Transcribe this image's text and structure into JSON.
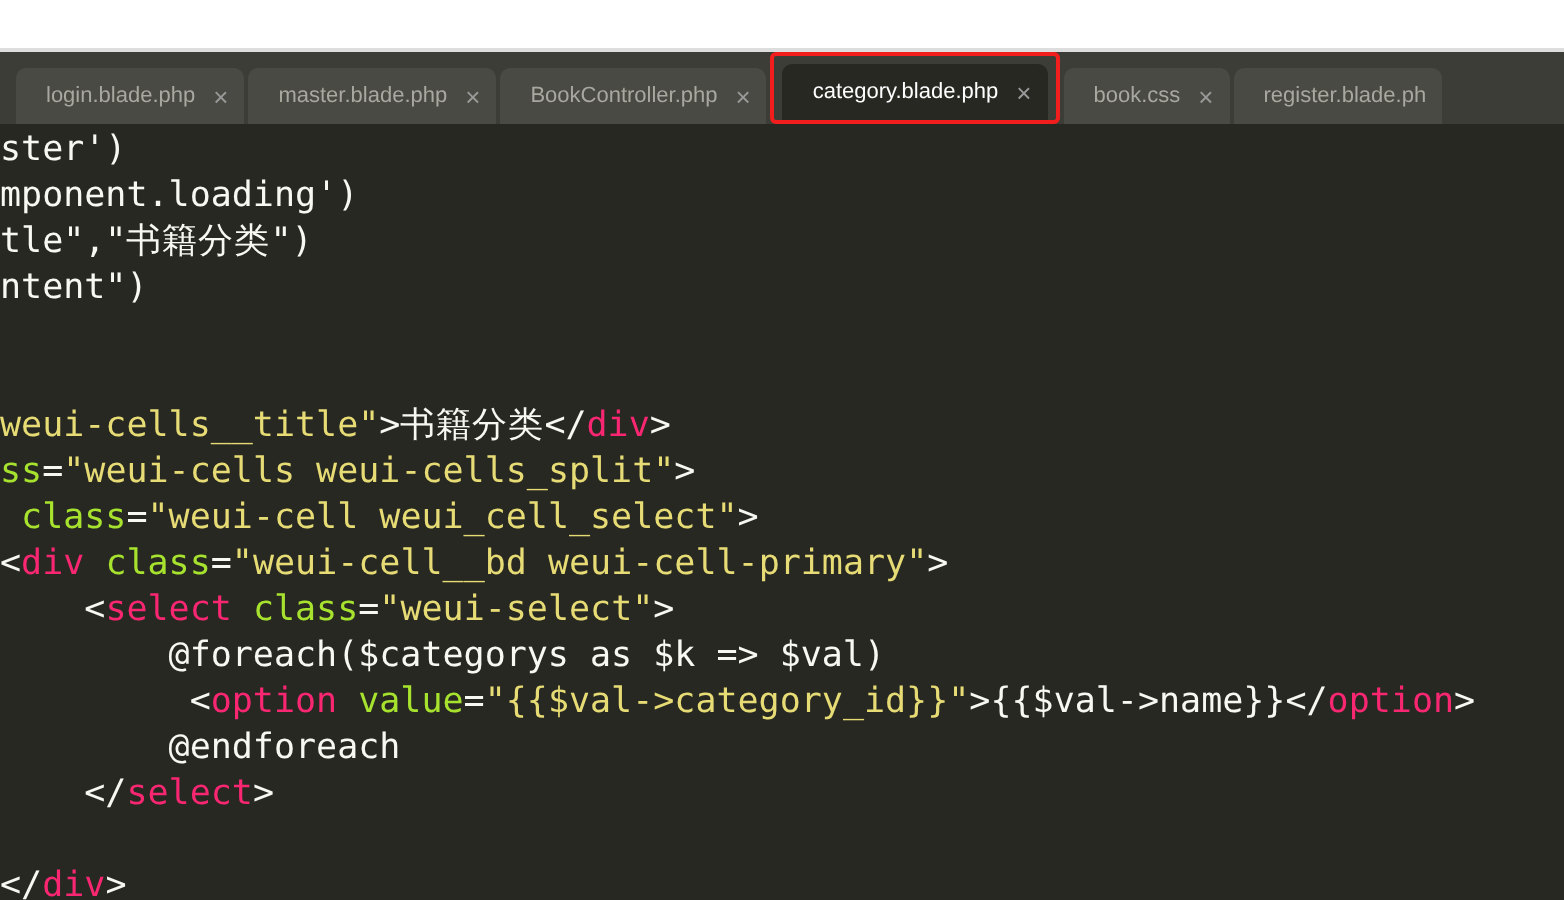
{
  "tabs": [
    {
      "label": "login.blade.php",
      "close": "×",
      "selected": false
    },
    {
      "label": "master.blade.php",
      "close": "×",
      "selected": false
    },
    {
      "label": "BookController.php",
      "close": "×",
      "selected": false
    },
    {
      "label": "category.blade.php",
      "close": "×",
      "selected": true
    },
    {
      "label": "book.css",
      "close": "×",
      "selected": false
    },
    {
      "label": "register.blade.ph",
      "selected": false
    }
  ],
  "code_lines": [
    {
      "kind": "code",
      "tokens": [
        {
          "kind": "plain",
          "text": "ster')"
        }
      ]
    },
    {
      "kind": "code",
      "tokens": [
        {
          "kind": "plain",
          "text": "mponent.loading')"
        }
      ]
    },
    {
      "kind": "code",
      "tokens": [
        {
          "kind": "plain",
          "text": "tle\",\"书籍分类\")"
        }
      ]
    },
    {
      "kind": "code",
      "tokens": [
        {
          "kind": "plain",
          "text": "ntent\")"
        }
      ]
    },
    {
      "kind": "blank"
    },
    {
      "kind": "blank"
    },
    {
      "kind": "code",
      "tokens": [
        {
          "kind": "string",
          "text": "weui-cells__title\""
        },
        {
          "kind": "plain",
          "text": ">书籍分类</"
        },
        {
          "kind": "tag",
          "text": "div"
        },
        {
          "kind": "plain",
          "text": ">"
        }
      ]
    },
    {
      "kind": "code",
      "tokens": [
        {
          "kind": "attr",
          "text": "ss"
        },
        {
          "kind": "plain",
          "text": "="
        },
        {
          "kind": "string",
          "text": "\"weui-cells weui-cells_split\""
        },
        {
          "kind": "plain",
          "text": ">"
        }
      ]
    },
    {
      "kind": "code",
      "tokens": [
        {
          "kind": "attr",
          "text": " class"
        },
        {
          "kind": "plain",
          "text": "="
        },
        {
          "kind": "string",
          "text": "\"weui-cell weui_cell_select\""
        },
        {
          "kind": "plain",
          "text": ">"
        }
      ]
    },
    {
      "kind": "code",
      "tokens": [
        {
          "kind": "plain",
          "text": "<"
        },
        {
          "kind": "tag",
          "text": "div"
        },
        {
          "kind": "attr",
          "text": " class"
        },
        {
          "kind": "plain",
          "text": "="
        },
        {
          "kind": "string",
          "text": "\"weui-cell__bd weui-cell-primary\""
        },
        {
          "kind": "plain",
          "text": ">"
        }
      ]
    },
    {
      "kind": "code",
      "tokens": [
        {
          "kind": "plain",
          "text": "    <"
        },
        {
          "kind": "tag",
          "text": "select"
        },
        {
          "kind": "attr",
          "text": " class"
        },
        {
          "kind": "plain",
          "text": "="
        },
        {
          "kind": "string",
          "text": "\"weui-select\""
        },
        {
          "kind": "plain",
          "text": ">"
        }
      ]
    },
    {
      "kind": "code",
      "tokens": [
        {
          "kind": "plain",
          "text": "        @foreach($categorys as $k => $val)"
        }
      ]
    },
    {
      "kind": "code",
      "tokens": [
        {
          "kind": "plain",
          "text": "         <"
        },
        {
          "kind": "tag",
          "text": "option"
        },
        {
          "kind": "attr",
          "text": " value"
        },
        {
          "kind": "plain",
          "text": "="
        },
        {
          "kind": "string",
          "text": "\"{{$val->category_id}}\""
        },
        {
          "kind": "plain",
          "text": ">{{$val->name}}</"
        },
        {
          "kind": "tag",
          "text": "option"
        },
        {
          "kind": "plain",
          "text": ">"
        }
      ]
    },
    {
      "kind": "code",
      "tokens": [
        {
          "kind": "plain",
          "text": "        @endforeach"
        }
      ]
    },
    {
      "kind": "code",
      "tokens": [
        {
          "kind": "plain",
          "text": "    </"
        },
        {
          "kind": "tag",
          "text": "select"
        },
        {
          "kind": "plain",
          "text": ">"
        }
      ]
    },
    {
      "kind": "blank"
    },
    {
      "kind": "code",
      "tokens": [
        {
          "kind": "plain",
          "text": "</"
        },
        {
          "kind": "tag",
          "text": "div"
        },
        {
          "kind": "plain",
          "text": ">"
        }
      ]
    }
  ]
}
